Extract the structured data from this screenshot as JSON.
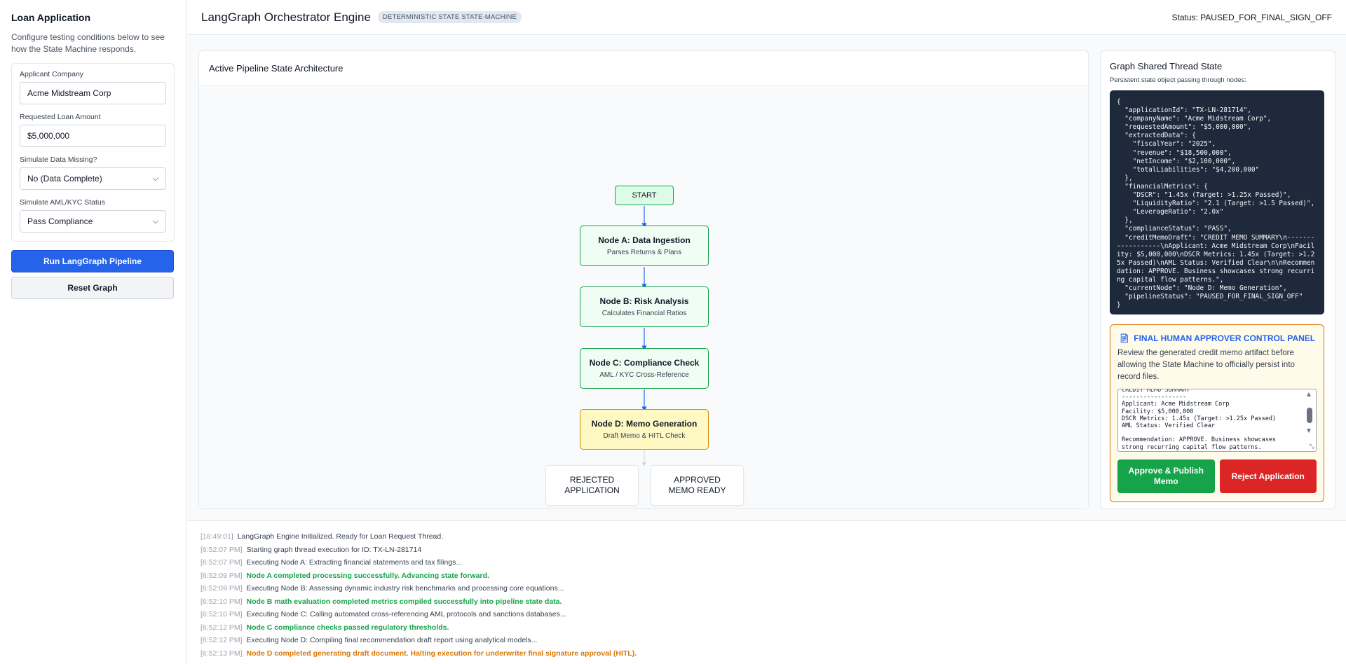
{
  "sidebar": {
    "title": "Loan Application",
    "description": "Configure testing conditions below to see how the State Machine responds.",
    "fields": {
      "company_label": "Applicant Company",
      "company_value": "Acme Midstream Corp",
      "amount_label": "Requested Loan Amount",
      "amount_value": "$5,000,000",
      "missing_label": "Simulate Data Missing?",
      "missing_value": "No (Data Complete)",
      "aml_label": "Simulate AML/KYC Status",
      "aml_value": "Pass Compliance"
    },
    "run_button": "Run LangGraph Pipeline",
    "reset_button": "Reset Graph"
  },
  "header": {
    "title": "LangGraph Orchestrator Engine",
    "tag": "DETERMINISTIC STATE STATE-MACHINE",
    "status": "Status: PAUSED_FOR_FINAL_SIGN_OFF"
  },
  "pipeline": {
    "title": "Active Pipeline State Architecture",
    "start": "START",
    "nodes": [
      {
        "title": "Node A: Data Ingestion",
        "subtitle": "Parses Returns & Plans"
      },
      {
        "title": "Node B: Risk Analysis",
        "subtitle": "Calculates Financial Ratios"
      },
      {
        "title": "Node C: Compliance Check",
        "subtitle": "AML / KYC Cross-Reference"
      },
      {
        "title": "Node D: Memo Generation",
        "subtitle": "Draft Memo & HITL Check"
      }
    ],
    "outcomes": {
      "rejected": "REJECTED APPLICATION",
      "approved": "APPROVED MEMO READY"
    }
  },
  "state": {
    "title": "Graph Shared Thread State",
    "subtitle": "Persistent state object passing through nodes:",
    "json": "{\n  \"applicationId\": \"TX-LN-281714\",\n  \"companyName\": \"Acme Midstream Corp\",\n  \"requestedAmount\": \"$5,000,000\",\n  \"extractedData\": {\n    \"fiscalYear\": \"2025\",\n    \"revenue\": \"$18,500,000\",\n    \"netIncome\": \"$2,100,000\",\n    \"totalLiabilities\": \"$4,200,000\"\n  },\n  \"financialMetrics\": {\n    \"DSCR\": \"1.45x (Target: >1.25x Passed)\",\n    \"LiquidityRatio\": \"2.1 (Target: >1.5 Passed)\",\n    \"LeverageRatio\": \"2.0x\"\n  },\n  \"complianceStatus\": \"PASS\",\n  \"creditMemoDraft\": \"CREDIT MEMO SUMMARY\\n------------------\\nApplicant: Acme Midstream Corp\\nFacility: $5,000,000\\nDSCR Metrics: 1.45x (Target: >1.25x Passed)\\nAML Status: Verified Clear\\n\\nRecommendation: APPROVE. Business showcases strong recurring capital flow patterns.\",\n  \"currentNode\": \"Node D: Memo Generation\",\n  \"pipelineStatus\": \"PAUSED_FOR_FINAL_SIGN_OFF\"\n}"
  },
  "approver": {
    "icon": "memo-icon",
    "title": "FINAL HUMAN APPROVER CONTROL PANEL",
    "description": "Review the generated credit memo artifact before allowing the State Machine to officially persist into record files.",
    "memo_text": "CREDIT MEMO SUMMARY\n------------------\nApplicant: Acme Midstream Corp\nFacility: $5,000,000\nDSCR Metrics: 1.45x (Target: >1.25x Passed)\nAML Status: Verified Clear\n\nRecommendation: APPROVE. Business showcases strong recurring capital flow patterns.",
    "approve_button": "Approve & Publish Memo",
    "reject_button": "Reject Application"
  },
  "log": [
    {
      "ts": "[18:49:01]",
      "msg": "LangGraph Engine Initialized. Ready for Loan Request Thread.",
      "level": "info"
    },
    {
      "ts": "[6:52:07 PM]",
      "msg": "Starting graph thread execution for ID: TX-LN-281714",
      "level": "info"
    },
    {
      "ts": "[6:52:07 PM]",
      "msg": "Executing Node A: Extracting financial statements and tax filings...",
      "level": "info"
    },
    {
      "ts": "[6:52:09 PM]",
      "msg": "Node A completed processing successfully. Advancing state forward.",
      "level": "success"
    },
    {
      "ts": "[6:52:09 PM]",
      "msg": "Executing Node B: Assessing dynamic industry risk benchmarks and processing core equations...",
      "level": "info"
    },
    {
      "ts": "[6:52:10 PM]",
      "msg": "Node B math evaluation completed metrics compiled successfully into pipeline state data.",
      "level": "success"
    },
    {
      "ts": "[6:52:10 PM]",
      "msg": "Executing Node C: Calling automated cross-referencing AML protocols and sanctions databases...",
      "level": "info"
    },
    {
      "ts": "[6:52:12 PM]",
      "msg": "Node C compliance checks passed regulatory thresholds.",
      "level": "success"
    },
    {
      "ts": "[6:52:12 PM]",
      "msg": "Executing Node D: Compiling final recommendation draft report using analytical models...",
      "level": "info"
    },
    {
      "ts": "[6:52:13 PM]",
      "msg": "Node D completed generating draft document. Halting execution for underwriter final signature approval (HITL).",
      "level": "warn"
    }
  ]
}
